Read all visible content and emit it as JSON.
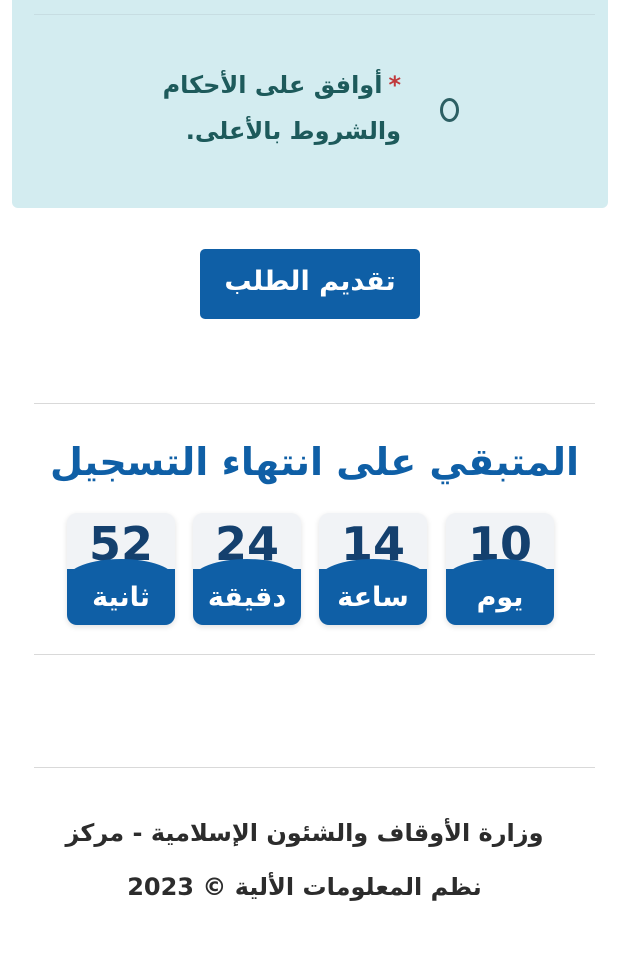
{
  "terms": {
    "required_mark": "*",
    "label": "أوافق على الأحكام والشروط بالأعلى."
  },
  "submit": {
    "label": "تقديم الطلب"
  },
  "countdown": {
    "title": "المتبقي على انتهاء التسجيل",
    "units": [
      {
        "value": "10",
        "label": "يوم"
      },
      {
        "value": "14",
        "label": "ساعة"
      },
      {
        "value": "24",
        "label": "دقيقة"
      },
      {
        "value": "52",
        "label": "ثانية"
      }
    ]
  },
  "footer": {
    "line1": "وزارة الأوقاف والشئون الإسلامية - مركز",
    "line2": "نظم المعلومات الألية © 2023"
  },
  "colors": {
    "primary": "#0f5fa6",
    "terms_bg": "#d3ecf0",
    "terms_text": "#1d5a5b",
    "required": "#c0393b"
  }
}
